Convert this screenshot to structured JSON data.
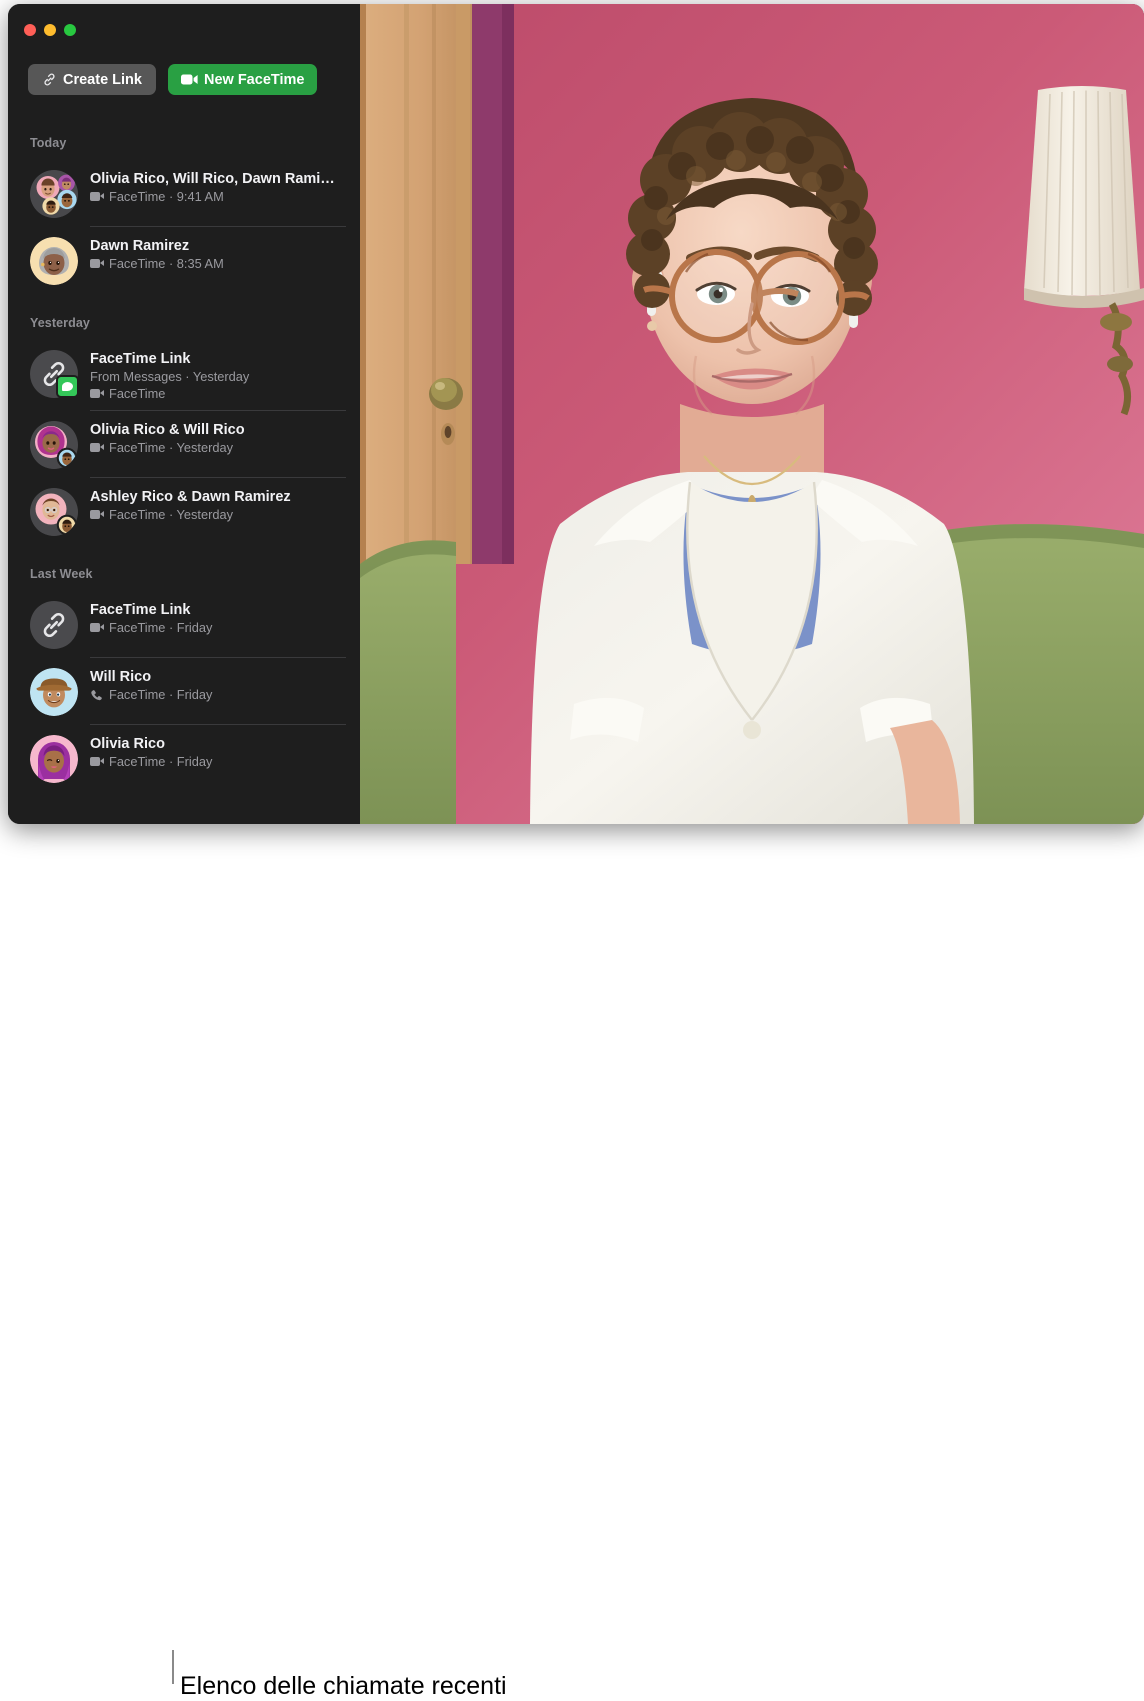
{
  "window": {
    "traffic_lights": [
      {
        "name": "close",
        "color": "#ff5f57"
      },
      {
        "name": "minimize",
        "color": "#febc2e"
      },
      {
        "name": "zoom",
        "color": "#28c840"
      }
    ]
  },
  "toolbar": {
    "create_link_label": "Create Link",
    "create_link_icon": "link-icon",
    "new_facetime_label": "New FaceTime",
    "new_facetime_icon": "video-camera-icon",
    "new_facetime_color": "#29a043",
    "create_link_color": "#575757"
  },
  "sidebar": {
    "sections": [
      {
        "title": "Today",
        "rows": [
          {
            "title": "Olivia Rico, Will Rico, Dawn Rami…",
            "sub_icon": "video-camera-icon",
            "sub": "FaceTime · 9:41 AM",
            "avatar": "group-memoji",
            "badge": null
          },
          {
            "title": "Dawn Ramirez",
            "sub_icon": "video-camera-icon",
            "sub": "FaceTime · 8:35 AM",
            "avatar": "memoji-dawn",
            "badge": null
          }
        ]
      },
      {
        "title": "Yesterday",
        "rows": [
          {
            "title": "FaceTime Link",
            "sub_top": "From Messages · Yesterday",
            "sub_icon": "video-camera-icon",
            "sub": "FaceTime",
            "avatar": "link-icon",
            "badge": "messages-badge"
          },
          {
            "title": "Olivia Rico & Will Rico",
            "sub_icon": "video-camera-icon",
            "sub": "FaceTime · Yesterday",
            "avatar": "memoji-olivia-will",
            "badge": null
          },
          {
            "title": "Ashley Rico & Dawn Ramirez",
            "sub_icon": "video-camera-icon",
            "sub": "FaceTime · Yesterday",
            "avatar": "memoji-ashley-dawn",
            "badge": null
          }
        ]
      },
      {
        "title": "Last Week",
        "rows": [
          {
            "title": "FaceTime Link",
            "sub_icon": "video-camera-icon",
            "sub": "FaceTime · Friday",
            "avatar": "link-icon",
            "badge": null
          },
          {
            "title": "Will Rico",
            "sub_icon": "phone-icon",
            "sub": "FaceTime · Friday",
            "avatar": "memoji-will",
            "badge": null
          },
          {
            "title": "Olivia Rico",
            "sub_icon": "video-camera-icon",
            "sub": "FaceTime · Friday",
            "avatar": "memoji-olivia",
            "badge": null
          }
        ]
      }
    ]
  },
  "video": {
    "description": "Live FaceTime video of a woman with short curly brown hair, tortoiseshell round glasses and AirPods, wearing a white shirt over a blue tee, seated on a green sofa in front of a pink wall with a wooden door and a pleated wall lamp.",
    "wall_color": "#c4516e",
    "door_color": "#d8a877",
    "sofa_color": "#93a667",
    "lamp_color": "#f2ece1",
    "shirt_color": "#f3f1ea",
    "tee_color": "#7b92c9"
  },
  "caption": {
    "text": "Elenco delle chiamate recenti"
  }
}
